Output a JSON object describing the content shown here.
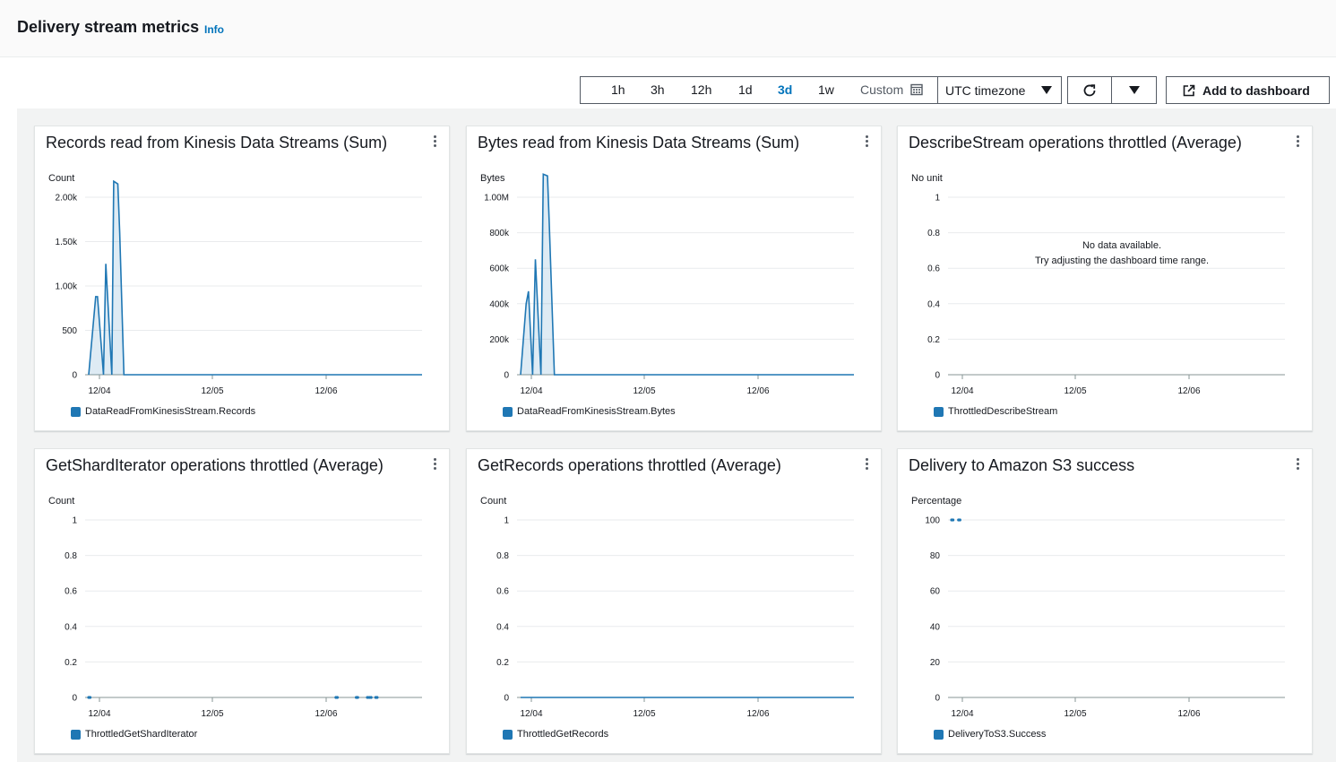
{
  "header": {
    "title": "Delivery stream metrics",
    "info_label": "Info"
  },
  "toolbar": {
    "ranges": [
      "1h",
      "3h",
      "12h",
      "1d",
      "3d",
      "1w"
    ],
    "active_range": "3d",
    "custom_label": "Custom",
    "timezone": "UTC timezone",
    "add_to_dashboard_label": "Add to dashboard"
  },
  "colors": {
    "series": "#1f77b4",
    "active": "#0073bb"
  },
  "panels": [
    {
      "title": "Records read from Kinesis Data Streams (Sum)",
      "unit": "Count",
      "legend": "DataReadFromKinesisStream.Records",
      "no_data": false,
      "chart_data": {
        "type": "line",
        "ylim": [
          0,
          2000
        ],
        "yticks": [
          0,
          500,
          1000,
          1500,
          2000
        ],
        "ytick_labels": [
          "0",
          "500",
          "1.00k",
          "1.50k",
          "2.00k"
        ],
        "xtick_labels": [
          "12/04",
          "12/05",
          "12/06"
        ],
        "x_hours": [
          0,
          1.5,
          1.9,
          3.2,
          3.7,
          5.0,
          5.4,
          6.3,
          6.7,
          7.6,
          8.0,
          9.0,
          72
        ],
        "values": [
          0,
          880,
          880,
          0,
          1250,
          0,
          2180,
          2150,
          1600,
          0,
          0,
          0,
          0
        ]
      }
    },
    {
      "title": "Bytes read from Kinesis Data Streams (Sum)",
      "unit": "Bytes",
      "legend": "DataReadFromKinesisStream.Bytes",
      "no_data": false,
      "chart_data": {
        "type": "line",
        "ylim": [
          0,
          1000000
        ],
        "yticks": [
          0,
          200000,
          400000,
          600000,
          800000,
          1000000
        ],
        "ytick_labels": [
          "0",
          "200k",
          "400k",
          "600k",
          "800k",
          "1.00M"
        ],
        "xtick_labels": [
          "12/04",
          "12/05",
          "12/06"
        ],
        "x_hours": [
          0,
          1.2,
          1.7,
          2.6,
          3.2,
          4.4,
          4.9,
          5.8,
          6.2,
          7.3,
          8.0,
          72
        ],
        "values": [
          0,
          400000,
          470000,
          0,
          650000,
          0,
          1130000,
          1120000,
          850000,
          0,
          0,
          0
        ]
      }
    },
    {
      "title": "DescribeStream operations throttled (Average)",
      "unit": "No unit",
      "legend": "ThrottledDescribeStream",
      "no_data": true,
      "no_data_line1": "No data available.",
      "no_data_line2": "Try adjusting the dashboard time range.",
      "chart_data": {
        "type": "line",
        "ylim": [
          0,
          1
        ],
        "yticks": [
          0,
          0.2,
          0.4,
          0.6,
          0.8,
          1
        ],
        "ytick_labels": [
          "0",
          "0.2",
          "0.4",
          "0.6",
          "0.8",
          "1"
        ],
        "xtick_labels": [
          "12/04",
          "12/05",
          "12/06"
        ],
        "x_hours": [],
        "values": []
      }
    },
    {
      "title": "GetShardIterator operations throttled (Average)",
      "unit": "Count",
      "legend": "ThrottledGetShardIterator",
      "no_data": false,
      "chart_data": {
        "type": "scatter",
        "ylim": [
          0,
          1
        ],
        "yticks": [
          0,
          0.2,
          0.4,
          0.6,
          0.8,
          1
        ],
        "ytick_labels": [
          "0",
          "0.2",
          "0.4",
          "0.6",
          "0.8",
          "1"
        ],
        "xtick_labels": [
          "12/04",
          "12/05",
          "12/06"
        ],
        "x_hours": [
          0,
          0.3,
          53.4,
          53.7,
          57.8,
          58.1,
          60.2,
          60.6,
          61.0,
          62.0,
          62.3
        ],
        "values": [
          0,
          0,
          0,
          0,
          0,
          0,
          0,
          0,
          0,
          0,
          0
        ]
      }
    },
    {
      "title": "GetRecords operations throttled (Average)",
      "unit": "Count",
      "legend": "ThrottledGetRecords",
      "no_data": false,
      "chart_data": {
        "type": "line",
        "ylim": [
          0,
          1
        ],
        "yticks": [
          0,
          0.2,
          0.4,
          0.6,
          0.8,
          1
        ],
        "ytick_labels": [
          "0",
          "0.2",
          "0.4",
          "0.6",
          "0.8",
          "1"
        ],
        "xtick_labels": [
          "12/04",
          "12/05",
          "12/06"
        ],
        "x_hours": [
          0,
          72
        ],
        "values": [
          0,
          0
        ]
      }
    },
    {
      "title": "Delivery to Amazon S3 success",
      "unit": "Percentage",
      "legend": "DeliveryToS3.Success",
      "no_data": false,
      "chart_data": {
        "type": "scatter",
        "ylim": [
          0,
          100
        ],
        "yticks": [
          0,
          20,
          40,
          60,
          80,
          100
        ],
        "ytick_labels": [
          "0",
          "20",
          "40",
          "60",
          "80",
          "100"
        ],
        "xtick_labels": [
          "12/04",
          "12/05",
          "12/06"
        ],
        "x_hours": [
          0,
          0.3,
          1.5,
          1.8
        ],
        "values": [
          100,
          100,
          100,
          100
        ]
      }
    }
  ]
}
